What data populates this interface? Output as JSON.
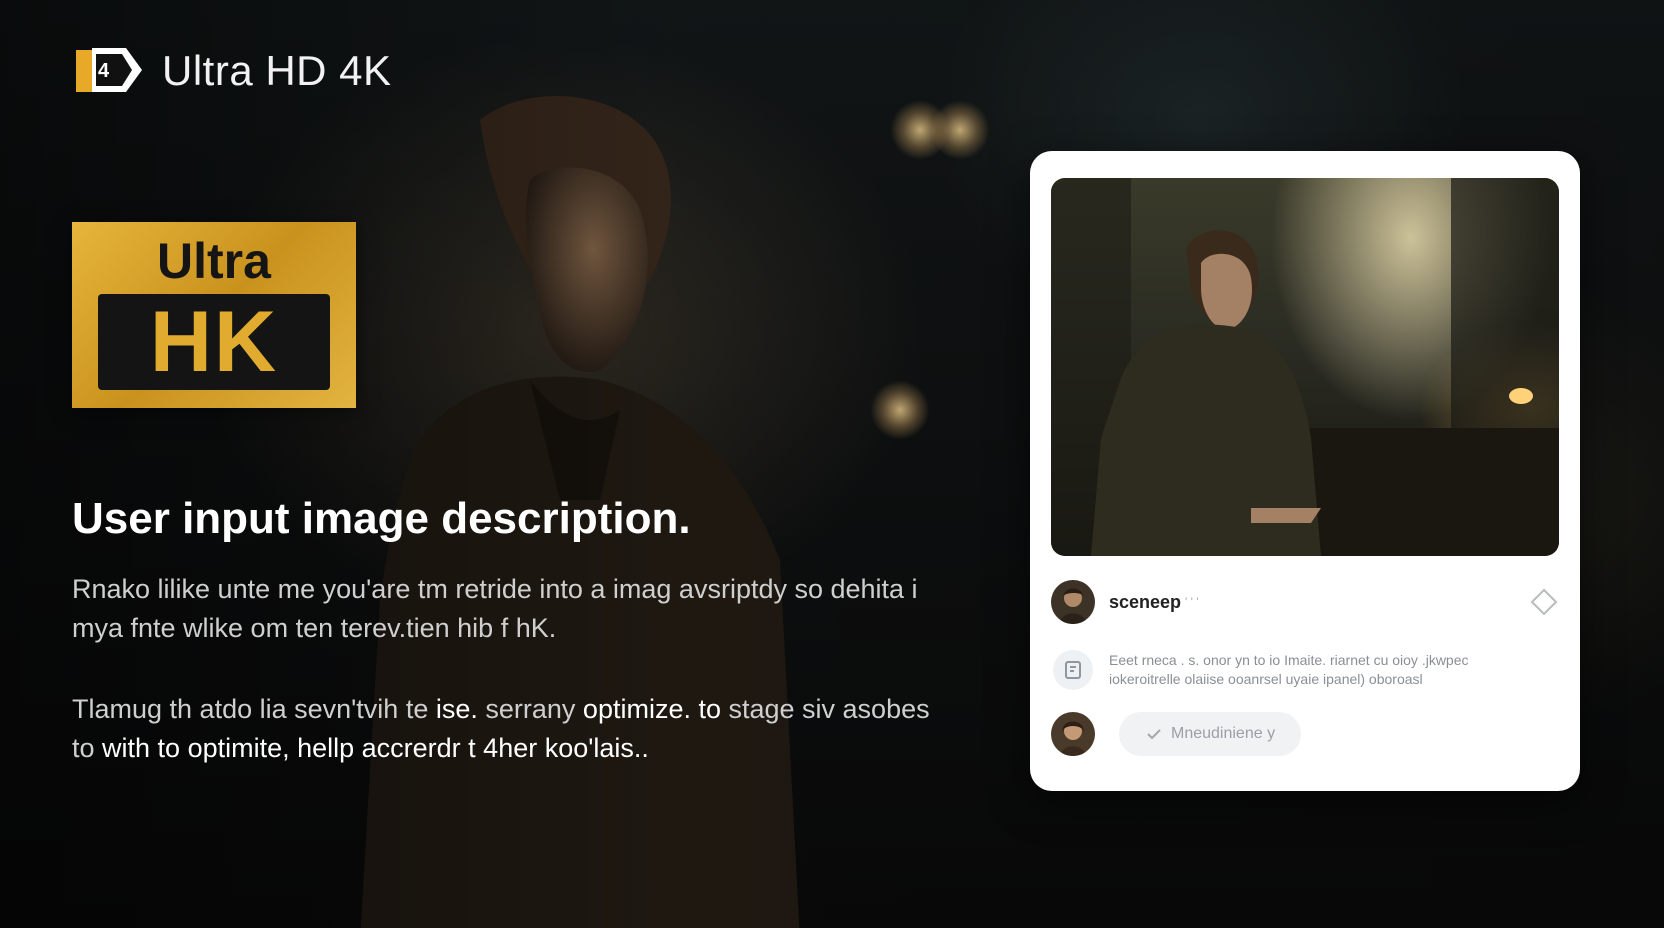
{
  "brand": {
    "title": "Ultra HD 4K",
    "logo_icon": "ultra-hd-4k-logo-icon"
  },
  "badge": {
    "top_label": "Ultra",
    "main_label": "HK"
  },
  "headline": "User input image description.",
  "paragraphs": {
    "first": "Rnako lilike unte me you'are tm retride into a imag avsriptdy so dehita i mya fnte wlike om ten terev.tien hib f hK.",
    "second_plain": "Tlamug th atdo lia sevn'tvih te ",
    "second_bold_1": "ise.",
    "second_plain_2": " serrany ",
    "second_bold_2": "optimize. to",
    "second_plain_3": " stage siv asobes to ",
    "second_bold_3": "with to optimite, hellp accrerdr t 4her koo'lais.."
  },
  "card": {
    "username": "sceneep",
    "username_suffix": "' ' '",
    "favorite_icon": "diamond-icon",
    "description_icon": "document-icon",
    "description": "Eeet rneca . s. onor yn to io Imaite. riarnet cu oioy .jkwpec iokeroitrelle olaiise ooanrsel uyaie ipanel) oboroasl",
    "verify_label": "Mneudiniene y"
  },
  "colors": {
    "accent_gold": "#e0ab2e",
    "background": "#0b0d0f",
    "card_bg": "#ffffff"
  }
}
